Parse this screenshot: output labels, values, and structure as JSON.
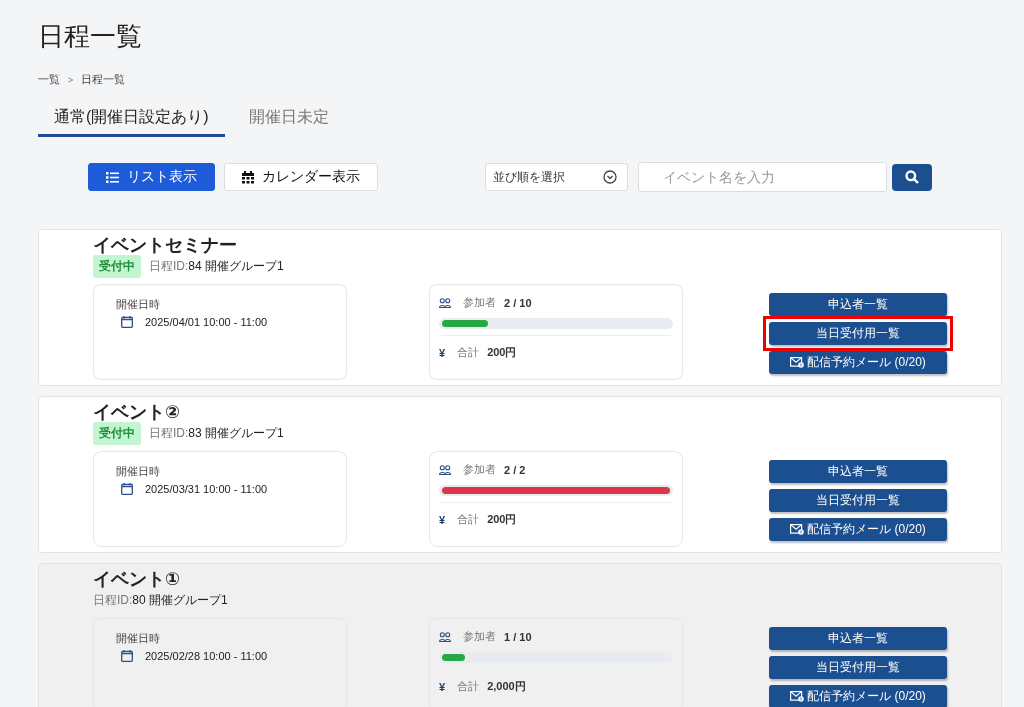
{
  "page_title": "日程一覧",
  "breadcrumb": [
    {
      "label": "一覧"
    },
    {
      "label": "日程一覧"
    }
  ],
  "breadcrumb_separator": ">",
  "tabs": [
    {
      "label": "通常(開催日設定あり)",
      "selected": true
    },
    {
      "label": "開催日未定",
      "selected": false
    }
  ],
  "view_buttons": [
    {
      "label": "リスト表示",
      "kind": "list",
      "selected": true
    },
    {
      "label": "カレンダー表示",
      "kind": "calendar",
      "selected": false
    }
  ],
  "sort_select": {
    "value": "並び順を選択"
  },
  "search": {
    "placeholder": "イベント名を入力"
  },
  "events": [
    {
      "title": "イベントセミナー",
      "status": "受付中",
      "closed": false,
      "id_label": "日程ID:",
      "id": "84",
      "group": "開催グループ1",
      "date_label": "開催日時",
      "datetime": "2025/04/01 10:00 - 11:00",
      "participants_label": "参加者",
      "participants": "2 /  10",
      "level": 0.2,
      "color": "#28a745",
      "currency_symbol": "¥",
      "total_label": "合計",
      "total": "200円",
      "buttons": [
        {
          "label": "申込者一覧",
          "kind": "plain",
          "highlighted": false
        },
        {
          "label": "当日受付用一覧",
          "kind": "plain",
          "highlighted": true
        },
        {
          "label": "配信予約メール (0/20)",
          "kind": "mail",
          "highlighted": false
        }
      ]
    },
    {
      "title": "イベント②",
      "status": "受付中",
      "closed": false,
      "id_label": "日程ID:",
      "id": "83",
      "group": "開催グループ1",
      "date_label": "開催日時",
      "datetime": "2025/03/31 10:00 - 11:00",
      "participants_label": "参加者",
      "participants": "2 /  2",
      "level": 1,
      "color": "#dc3545",
      "currency_symbol": "¥",
      "total_label": "合計",
      "total": "200円",
      "buttons": [
        {
          "label": "申込者一覧",
          "kind": "plain",
          "highlighted": false
        },
        {
          "label": "当日受付用一覧",
          "kind": "plain",
          "highlighted": false
        },
        {
          "label": "配信予約メール (0/20)",
          "kind": "mail",
          "highlighted": false
        }
      ]
    },
    {
      "title": "イベント①",
      "closed": true,
      "id_label": "日程ID:",
      "id": "80",
      "group": "開催グループ1",
      "date_label": "開催日時",
      "datetime": "2025/02/28 10:00 - 11:00",
      "participants_label": "参加者",
      "participants": "1 /  10",
      "level": 0.1,
      "color": "#28a745",
      "currency_symbol": "¥",
      "total_label": "合計",
      "total": "2,000円",
      "buttons": [
        {
          "label": "申込者一覧",
          "kind": "plain",
          "highlighted": false
        },
        {
          "label": "当日受付用一覧",
          "kind": "plain",
          "highlighted": false
        },
        {
          "label": "配信予約メール (0/20)",
          "kind": "mail",
          "highlighted": false
        }
      ]
    }
  ]
}
